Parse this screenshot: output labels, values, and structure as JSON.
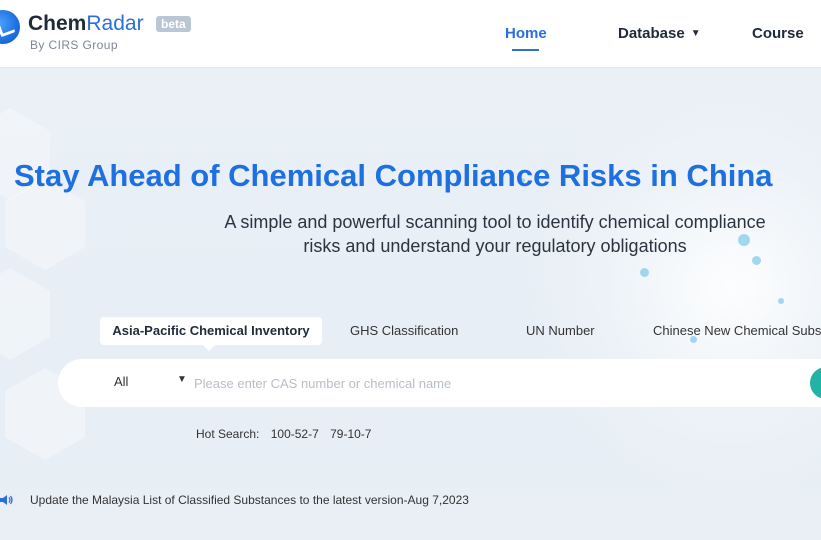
{
  "header": {
    "brand_bold": "Chem",
    "brand_light": "Radar",
    "beta": "beta",
    "byline": "By CIRS Group",
    "nav": [
      {
        "label": "Home"
      },
      {
        "label": "Database"
      },
      {
        "label": "Course"
      }
    ],
    "accent": "#2a6fdc"
  },
  "hero": {
    "title": "Stay Ahead of Chemical Compliance Risks in China",
    "subtitle_line1": "A simple and powerful scanning tool to identify chemical compliance",
    "subtitle_line2": "risks and understand your regulatory obligations"
  },
  "tabs": [
    {
      "label": "Asia-Pacific Chemical Inventory",
      "active": true
    },
    {
      "label": "GHS Classification",
      "active": false
    },
    {
      "label": "UN Number",
      "active": false
    },
    {
      "label": "Chinese New Chemical Substance",
      "active": false
    }
  ],
  "search": {
    "scope": "All",
    "placeholder": "Please enter CAS number or chemical name",
    "button_color": "#22b3a7"
  },
  "hot_search": {
    "label": "Hot Search:",
    "items": [
      "100-52-7",
      "79-10-7"
    ]
  },
  "notice": {
    "text": "Update the Malaysia List of Classified Substances to the latest version-Aug 7,2023"
  }
}
